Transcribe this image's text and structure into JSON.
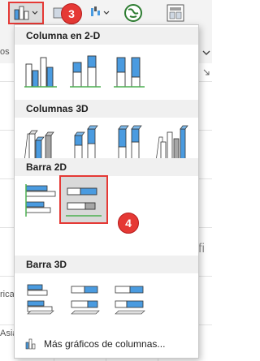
{
  "badges": {
    "step3": "3",
    "step4": "4"
  },
  "sections": {
    "col2d": {
      "title": "Columna en 2-D"
    },
    "col3d": {
      "title": "Columnas 3D"
    },
    "bar2d": {
      "title": "Barra 2D"
    },
    "bar3d": {
      "title": "Barra 3D"
    }
  },
  "more": {
    "label": "Más gráficos de columnas..."
  },
  "background": {
    "left_fragment_1": "os",
    "left_fragment_2": "rica",
    "left_fragment_3": "Asia",
    "right_fragment": "fi"
  },
  "colors": {
    "accent": "#e53935",
    "blue": "#4a9be0",
    "gray": "#a6a6a6",
    "panel_bg": "#ffffff",
    "section_bg": "#f0f0f0"
  },
  "icons": {
    "chart_button": "clustered-column-icon",
    "toolbar_2": "bar-chart-icon",
    "toolbar_3": "waterfall-icon",
    "toolbar_4": "globe-map-icon",
    "toolbar_5": "pivot-chart-icon",
    "more": "column-chart-small-icon"
  }
}
